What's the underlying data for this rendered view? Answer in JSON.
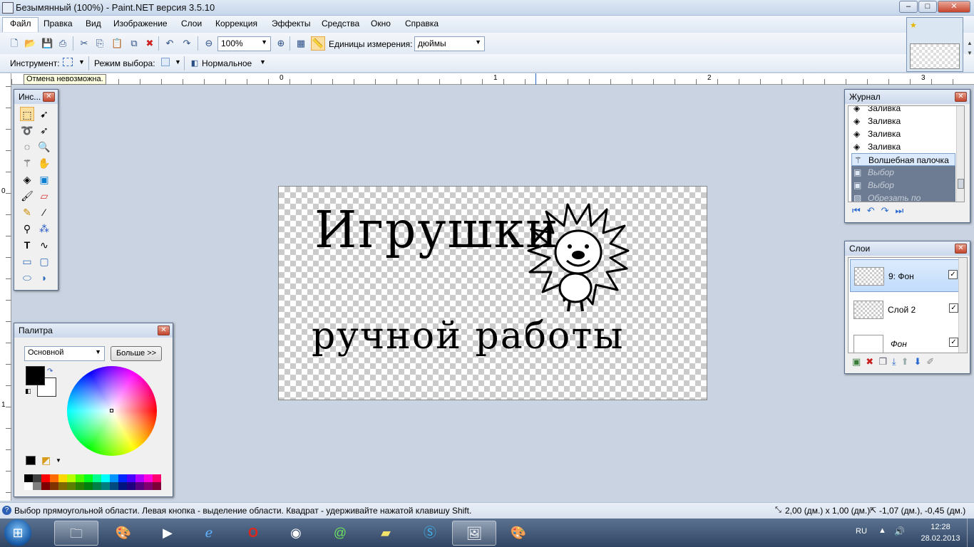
{
  "window": {
    "title": "Безымянный (100%) - Paint.NET версия 3.5.10",
    "min": "–",
    "max": "□",
    "close": "✕"
  },
  "menu": [
    "Файл",
    "Правка",
    "Вид",
    "Изображение",
    "Слои",
    "Коррекция",
    "Эффекты",
    "Средства",
    "Окно",
    "Справка"
  ],
  "toolbar": {
    "zoom_value": "100%",
    "units_label": "Единицы измерения:",
    "units_value": "дюймы"
  },
  "toolbar2": {
    "tool_label": "Инструмент:",
    "selmode_label": "Режим выбора:",
    "blend_value": "Нормальное"
  },
  "tooltip": "Отмена невозможна.",
  "ruler": {
    "unit": "дм",
    "top_marks": [
      "0",
      "1",
      "2",
      "3"
    ],
    "left_marks": [
      "0",
      "1"
    ]
  },
  "canvas": {
    "line1": "Игрушки",
    "line2": "ручной работы"
  },
  "tools_panel": {
    "title": "Инс..."
  },
  "palette": {
    "title": "Палитра",
    "mode": "Основной",
    "more_button": "Больше >>",
    "colors": [
      "#000000",
      "#404040",
      "#ff0000",
      "#ff6a00",
      "#ffd800",
      "#b6ff00",
      "#4cff00",
      "#00ff21",
      "#00ff90",
      "#00ffff",
      "#0094ff",
      "#0026ff",
      "#4800ff",
      "#b200ff",
      "#ff00dc",
      "#ff006e",
      "#ffffff",
      "#808080",
      "#7f0000",
      "#7f3300",
      "#7f6a00",
      "#5b7f00",
      "#267f00",
      "#007f0e",
      "#007f46",
      "#007f7f",
      "#004a7f",
      "#00137f",
      "#21007f",
      "#57007f",
      "#7f006e",
      "#7f0037"
    ],
    "primary": "#000000",
    "secondary": "#ffffff"
  },
  "history": {
    "title": "Журнал",
    "items": [
      {
        "label": "Заливка",
        "state": "done"
      },
      {
        "label": "Заливка",
        "state": "done"
      },
      {
        "label": "Заливка",
        "state": "done"
      },
      {
        "label": "Заливка",
        "state": "done"
      },
      {
        "label": "Волшебная палочка",
        "state": "current"
      },
      {
        "label": "Выбор прямоугольной...",
        "state": "undone"
      },
      {
        "label": "Выбор прямоугольной...",
        "state": "undone"
      },
      {
        "label": "Обрезать по выделен...",
        "state": "undone"
      }
    ]
  },
  "layers": {
    "title": "Слои",
    "items": [
      {
        "name": "9: Фон",
        "checked": "✓",
        "selected": true
      },
      {
        "name": "Слой 2",
        "checked": "✓",
        "selected": false
      },
      {
        "name": "Фон",
        "checked": "✓",
        "selected": false
      }
    ]
  },
  "status": {
    "hint": "Выбор прямоугольной области. Левая кнопка - выделение области. Квадрат - удерживайте нажатой клавишу Shift.",
    "size": "2,00 (дм.) x 1,00 (дм.)",
    "pos": "-1,07 (дм.), -0,45 (дм.)"
  },
  "taskbar": {
    "lang": "RU",
    "time": "12:28",
    "date": "28.02.2013"
  }
}
